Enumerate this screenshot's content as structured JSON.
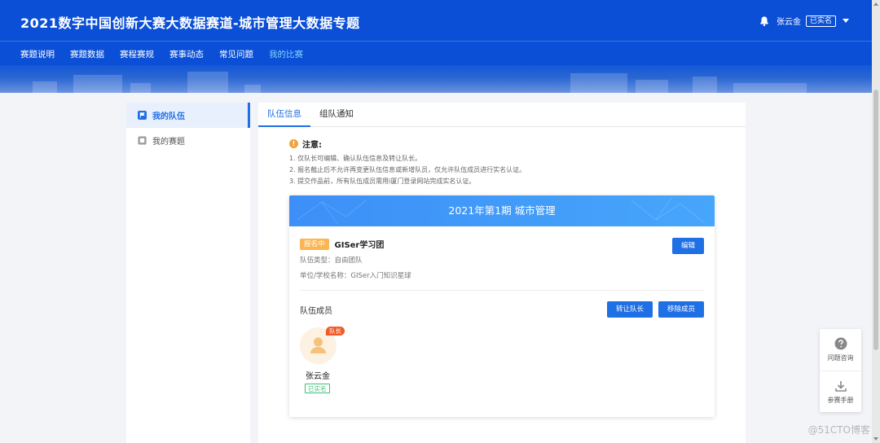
{
  "header": {
    "title": "2021数字中国创新大赛大数据赛道-城市管理大数据专题",
    "user_name": "张云金",
    "user_badge": "已实名",
    "nav": [
      "赛题说明",
      "赛题数据",
      "赛程赛规",
      "赛事动态",
      "常见问题",
      "我的比赛"
    ],
    "active_nav": "我的比赛"
  },
  "sidebar": {
    "items": [
      {
        "label": "我的队伍",
        "icon": "flag-icon",
        "active": true
      },
      {
        "label": "我的赛题",
        "icon": "square-icon",
        "active": false
      }
    ]
  },
  "tabs": [
    {
      "label": "队伍信息",
      "active": true
    },
    {
      "label": "组队通知",
      "active": false
    }
  ],
  "notice": {
    "title": "注意:",
    "lines": [
      "1. 仅队长可编辑、确认队伍信息及转让队长。",
      "2. 报名截止后不允许再变更队伍信息或新增队员，仅允许队伍成员进行实名认证。",
      "3. 提交作品前，所有队伍成员需用i厦门登录网站完成实名认证。"
    ]
  },
  "card": {
    "header": "2021年第1期 城市管理",
    "status": "报名中",
    "team_name": "GISer学习团",
    "team_type": "队伍类型：自由团队",
    "school": "单位/学校名称：GISer入门知识星球",
    "edit_label": "编辑",
    "members_label": "队伍成员",
    "transfer_label": "转让队长",
    "remove_label": "移除成员",
    "members": [
      {
        "name": "张云金",
        "role": "队长",
        "verified": "已实名"
      }
    ]
  },
  "float_panel": {
    "help": "问题咨询",
    "manual": "参赛手册"
  },
  "watermark": "@51CTO博客",
  "colors": {
    "header": "#0a4fd6",
    "accent": "#1f6fe5",
    "status_tag": "#fbb553",
    "captain_tag": "#f05a2a",
    "verified": "#3bbf7a"
  }
}
